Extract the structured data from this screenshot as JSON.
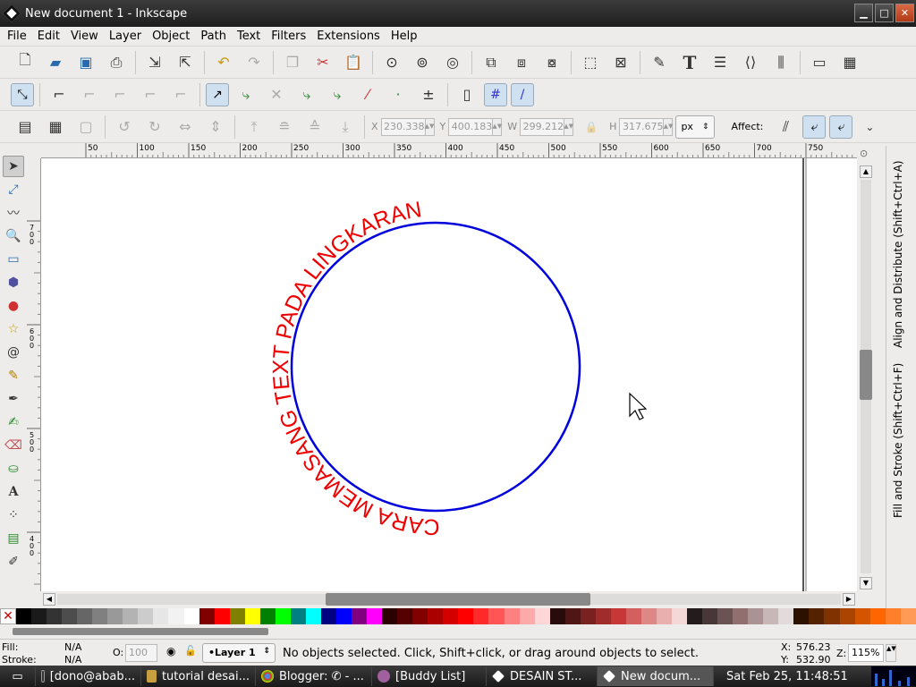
{
  "window": {
    "title": "New document 1 - Inkscape",
    "min": "▁",
    "max": "□",
    "close": "✕"
  },
  "menu": [
    "File",
    "Edit",
    "View",
    "Layer",
    "Object",
    "Path",
    "Text",
    "Filters",
    "Extensions",
    "Help"
  ],
  "toolbar3": {
    "x_label": "X",
    "x_value": "230.338",
    "y_label": "Y",
    "y_value": "400.183",
    "w_label": "W",
    "w_value": "299.212",
    "h_label": "H",
    "h_value": "317.675",
    "unit": "px",
    "affect_label": "Affect:"
  },
  "ruler": {
    "h_ticks": [
      "50",
      "100",
      "150",
      "200",
      "250",
      "300",
      "350",
      "400",
      "450",
      "500",
      "550",
      "600",
      "650",
      "700",
      "750"
    ],
    "v_ticks": [
      "700",
      "600",
      "500",
      "400"
    ]
  },
  "canvas": {
    "path_text": "TEXT PADA LINGKARAN",
    "path_text_bottom": "CARA MEMASANG TEXT PADA LINGKARAN",
    "circle_color": "#0000dd",
    "text_color": "#ee0000"
  },
  "dock": {
    "tab1": "Align and Distribute (Shift+Ctrl+A)",
    "tab2": "Fill and Stroke (Shift+Ctrl+F)"
  },
  "status": {
    "fill_label": "Fill:",
    "fill_value": "N/A",
    "stroke_label": "Stroke:",
    "stroke_value": "N/A",
    "opacity_label": "O:",
    "opacity_value": "100",
    "layer": "•Layer 1",
    "message": "No objects selected. Click, Shift+click, or drag around objects to select.",
    "x_label": "X:",
    "x_value": "576.23",
    "y_label": "Y:",
    "y_value": "532.90",
    "zoom_label": "Z:",
    "zoom_value": "115%"
  },
  "taskbar": {
    "tasks": [
      "[dono@abab...",
      "tutorial desai...",
      "Blogger: ✆ - ...",
      "[Buddy List]",
      "DESAIN ST...",
      "New docum..."
    ],
    "clock": "Sat Feb 25, 11:48:51"
  },
  "palette_colors": [
    "#000000",
    "#1a1a1a",
    "#333333",
    "#4d4d4d",
    "#666666",
    "#808080",
    "#999999",
    "#b3b3b3",
    "#cccccc",
    "#e6e6e6",
    "#f2f2f2",
    "#ffffff",
    "#800000",
    "#ff0000",
    "#808000",
    "#ffff00",
    "#008000",
    "#00ff00",
    "#008080",
    "#00ffff",
    "#000080",
    "#0000ff",
    "#800080",
    "#ff00ff",
    "#2b0000",
    "#550000",
    "#800000",
    "#aa0000",
    "#d40000",
    "#ff0000",
    "#ff2a2a",
    "#ff5555",
    "#ff8080",
    "#ffaaaa",
    "#ffd5d5",
    "#280b0b",
    "#501616",
    "#782121",
    "#a02c2c",
    "#c83737",
    "#d35f5f",
    "#de8787",
    "#e9afaf",
    "#f4d7d7",
    "#241c1c",
    "#483737",
    "#6c5353",
    "#916f6f",
    "#ac9393",
    "#c8b7b7",
    "#e3dbdb",
    "#2b1100",
    "#552200",
    "#803300",
    "#aa4400",
    "#d45500",
    "#ff6600",
    "#ff7f2a",
    "#ff9955"
  ]
}
